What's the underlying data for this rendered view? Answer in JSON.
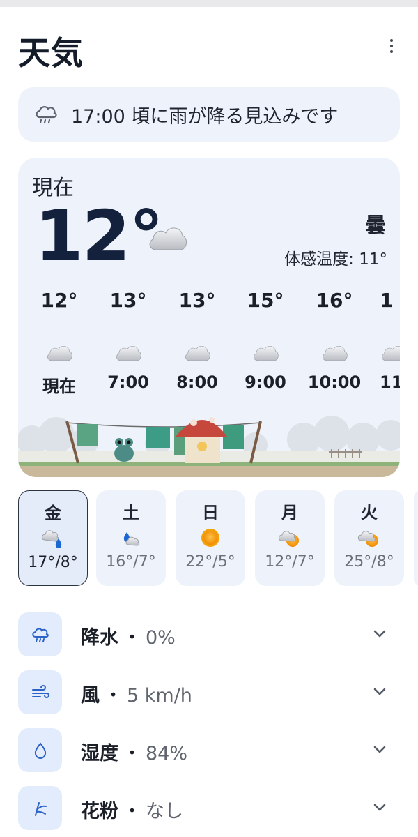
{
  "header": {
    "title": "天気"
  },
  "alert": {
    "text": "17:00 頃に雨が降る見込みです"
  },
  "current": {
    "label": "現在",
    "temp": "12°",
    "condition": "曇",
    "feels_like": "体感温度: 11°",
    "icon": "cloud-icon"
  },
  "hourly": [
    {
      "temp": "12°",
      "time": "現在",
      "icon": "cloud-icon"
    },
    {
      "temp": "13°",
      "time": "7:00",
      "icon": "cloud-icon"
    },
    {
      "temp": "13°",
      "time": "8:00",
      "icon": "cloud-icon"
    },
    {
      "temp": "15°",
      "time": "9:00",
      "icon": "cloud-icon"
    },
    {
      "temp": "16°",
      "time": "10:00",
      "icon": "cloud-icon"
    },
    {
      "temp": "1",
      "time": "11",
      "icon": "cloud-icon"
    }
  ],
  "daily": [
    {
      "day": "金",
      "temps": "17°/8°",
      "icon": "cloud-rain-icon",
      "selected": true
    },
    {
      "day": "土",
      "temps": "16°/7°",
      "icon": "cloud-rain-icon",
      "selected": false
    },
    {
      "day": "日",
      "temps": "22°/5°",
      "icon": "sun-icon",
      "selected": false
    },
    {
      "day": "月",
      "temps": "12°/7°",
      "icon": "partly-cloudy-icon",
      "selected": false
    },
    {
      "day": "火",
      "temps": "25°/8°",
      "icon": "partly-cloudy-icon",
      "selected": false
    }
  ],
  "details": [
    {
      "key": "降水",
      "value": "0%",
      "icon": "rain-cloud-icon"
    },
    {
      "key": "風",
      "value": "5 km/h",
      "icon": "wind-icon"
    },
    {
      "key": "湿度",
      "value": "84%",
      "icon": "droplet-icon"
    },
    {
      "key": "花粉",
      "value": "なし",
      "icon": "pollen-icon"
    }
  ],
  "colors": {
    "card_bg": "#eef3fb",
    "accent": "#2b62c7",
    "title": "#141c2a"
  }
}
